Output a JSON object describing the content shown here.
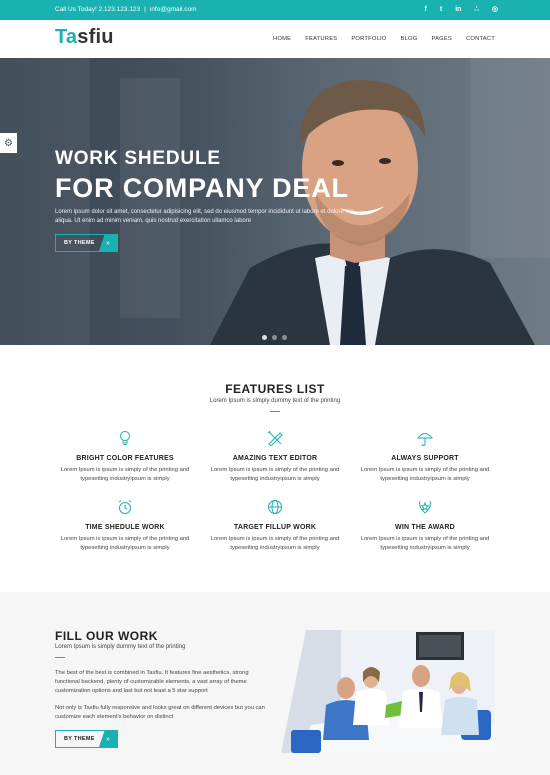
{
  "topbar": {
    "phone": "Call Us Today! 2.123.123.123",
    "separator": "|",
    "email": "info@gmail.com",
    "socials": [
      {
        "icon": "facebook-icon",
        "glyph": "f"
      },
      {
        "icon": "twitter-icon",
        "glyph": "t"
      },
      {
        "icon": "linkedin-icon",
        "glyph": "in"
      },
      {
        "icon": "rss-icon",
        "glyph": "∴"
      },
      {
        "icon": "dribbble-icon",
        "glyph": "◎"
      }
    ],
    "color": "#1ab1b1"
  },
  "header": {
    "logo_accent": "Ta",
    "logo_rest": "sfiu",
    "nav": [
      "HOME",
      "FEATURES",
      "PORTFOLIO",
      "BLOG",
      "PAGES",
      "CONTACT"
    ]
  },
  "hero": {
    "subtitle": "WORK SHEDULE",
    "title": "FOR COMPANY DEAL",
    "text": "Lorem ipsum dolor sit amet, consectetur adipisicing elit, sed do eiusmod tempor incididunt ut labore et dolore ma aliqua. Ut enim ad minim veniam, quis nostrud exercitation ullamco labore",
    "button": "BY THEME",
    "button_arrow": "»",
    "slides": 3,
    "active_slide": 1
  },
  "features": {
    "title": "FEATURES LIST",
    "subtitle": "Lorem Ipsum is simply dummy text of the printing",
    "items": [
      {
        "icon": "lightbulb-icon",
        "title": "BRIGHT COLOR FEATURES",
        "text": "Lorem Ipsum is ipsum is simply of the printing and typesetting industryipsum is simply"
      },
      {
        "icon": "pencil-ruler-icon",
        "title": "AMAZING TEXT EDITOR",
        "text": "Lorem Ipsum is ipsum is simply of the printing and typesetting industryipsum is simply"
      },
      {
        "icon": "umbrella-icon",
        "title": "ALWAYS SUPPORT",
        "text": "Lorem Ipsum is ipsum is simply of the printing and typesetting industryipsum is simply"
      },
      {
        "icon": "alarm-clock-icon",
        "title": "TIME SHEDULE WORK",
        "text": "Lorem Ipsum is ipsum is simply of the printing and typesetting industryipsum is simply"
      },
      {
        "icon": "globe-icon",
        "title": "TARGET FILLUP WORK",
        "text": "Lorem Ipsum is ipsum is simply of the printing and typesetting industryipsum is simply"
      },
      {
        "icon": "award-icon",
        "title": "WIN THE AWARD",
        "text": "Lorem Ipsum is ipsum is simply of the printing and typesetting industryipsum is simply"
      }
    ]
  },
  "work": {
    "title": "FILL OUR WORK",
    "subtitle": "Lorem Ipsum is simply dummy text of the printing",
    "paragraph1": "The best of the best is combined in Tasfiu. It features fine aesthetics, strong functional backend, plenty of customizable elements, a vast array of theme customization options and last but not least a 5 star support",
    "paragraph2": "Not only is Tasfiu fully responsive and looks great on different devices but you can customize each element's behavior on distinct",
    "button": "BY THEME",
    "button_arrow": "»"
  }
}
